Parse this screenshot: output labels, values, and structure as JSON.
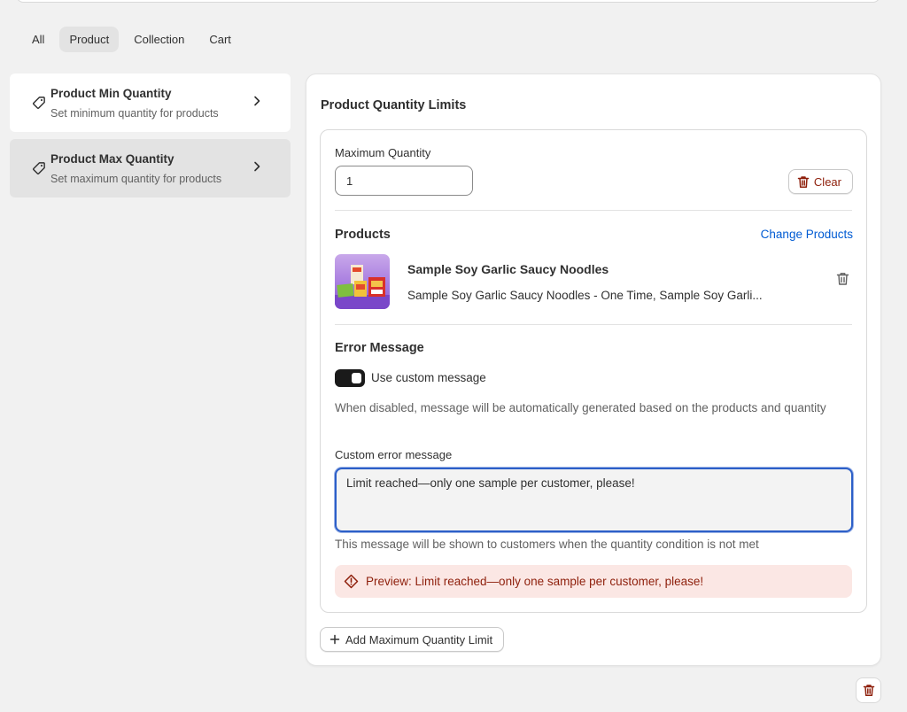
{
  "tabs": [
    {
      "label": "All",
      "active": false
    },
    {
      "label": "Product",
      "active": true
    },
    {
      "label": "Collection",
      "active": false
    },
    {
      "label": "Cart",
      "active": false
    }
  ],
  "sidebar": {
    "items": [
      {
        "title": "Product Min Quantity",
        "subtitle": "Set minimum quantity for products",
        "icon": "tag-icon",
        "selected": false
      },
      {
        "title": "Product Max Quantity",
        "subtitle": "Set maximum quantity for products",
        "icon": "tag-icon",
        "selected": true
      }
    ]
  },
  "main": {
    "title": "Product Quantity Limits",
    "max_quantity_label": "Maximum Quantity",
    "max_quantity_value": "1",
    "clear_label": "Clear",
    "products_title": "Products",
    "change_products_label": "Change Products",
    "product": {
      "title": "Sample Soy Garlic Saucy Noodles",
      "subtitle": "Sample Soy Garlic Saucy Noodles - One Time, Sample Soy Garli..."
    },
    "error_title": "Error Message",
    "toggle_label": "Use custom message",
    "toggle_on": true,
    "toggle_help": "When disabled, message will be automatically generated based on the products and quantity",
    "custom_label": "Custom error message",
    "custom_value": "Limit reached—only one sample per customer, please!",
    "custom_help": "This message will be shown to customers when the quantity condition is not met",
    "preview_text": "Preview: Limit reached—only one sample per customer, please!",
    "add_button_label": "Add Maximum Quantity Limit"
  },
  "colors": {
    "accent_link": "#005bd3",
    "critical": "#8e1f0b",
    "preview_bg": "#fbe7e4",
    "focus_ring": "#2c5fc8"
  }
}
